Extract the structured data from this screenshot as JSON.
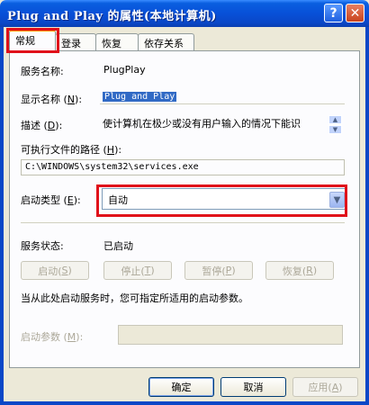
{
  "window": {
    "title": "Plug and Play 的属性(本地计算机)"
  },
  "tabs": [
    "常规",
    "登录",
    "恢复",
    "依存关系"
  ],
  "general": {
    "service_name_label": "服务名称:",
    "service_name_value": "PlugPlay",
    "display_name_label_pre": "显示名称 (",
    "display_name_label_key": "N",
    "display_name_label_post": "):",
    "display_name_value": "Plug and Play",
    "description_label_pre": "描述 (",
    "description_label_key": "D",
    "description_label_post": "):",
    "description_value": "使计算机在极少或没有用户输入的情况下能识",
    "exe_path_label_pre": "可执行文件的路径 (",
    "exe_path_label_key": "H",
    "exe_path_label_post": "):",
    "exe_path_value": "C:\\WINDOWS\\system32\\services.exe",
    "startup_type_label_pre": "启动类型 (",
    "startup_type_label_key": "E",
    "startup_type_label_post": "):",
    "startup_type_value": "自动",
    "service_status_label": "服务状态:",
    "service_status_value": "已启动",
    "start_btn_pre": "启动(",
    "start_btn_key": "S",
    "start_btn_post": ")",
    "stop_btn_pre": "停止(",
    "stop_btn_key": "T",
    "stop_btn_post": ")",
    "pause_btn_pre": "暂停(",
    "pause_btn_key": "P",
    "pause_btn_post": ")",
    "resume_btn_pre": "恢复(",
    "resume_btn_key": "R",
    "resume_btn_post": ")",
    "hint": "当从此处启动服务时，您可指定所适用的启动参数。",
    "start_params_label_pre": "启动参数 (",
    "start_params_label_key": "M",
    "start_params_label_post": "):",
    "start_params_value": ""
  },
  "footer": {
    "ok": "确定",
    "cancel": "取消",
    "apply_pre": "应用(",
    "apply_key": "A",
    "apply_post": ")"
  },
  "colors": {
    "highlight_box": "#e0101a",
    "title_blue": "#0850d8",
    "selection": "#316ac5"
  }
}
